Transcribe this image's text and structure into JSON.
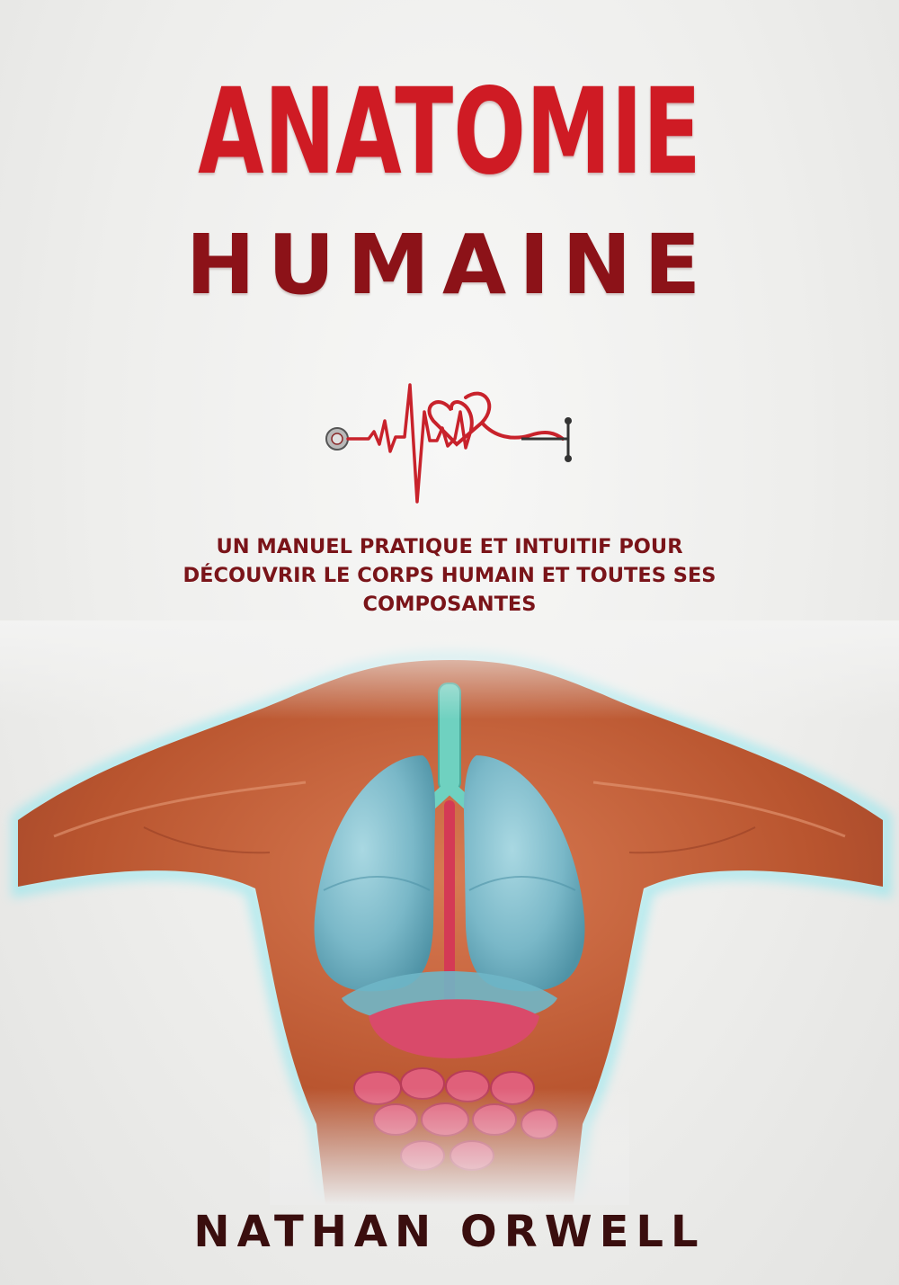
{
  "cover": {
    "title_line1": "ANATOMIE",
    "title_line2": "HUMAINE",
    "subtitle_line1": "UN MANUEL PRATIQUE ET INTUITIF POUR",
    "subtitle_line2": "DÉCOUVRIR LE CORPS HUMAIN ET TOUTES SES",
    "subtitle_line3": "COMPOSANTES",
    "author": "NATHAN ORWELL"
  },
  "icons": {
    "heartbeat": "stethoscope-heartbeat-icon",
    "illustration": "human-torso-anatomy-illustration"
  },
  "colors": {
    "title_red": "#cf1b24",
    "title_dark_red": "#8c1218",
    "subtitle": "#7a1419",
    "author": "#3a0e0e",
    "lungs": "#7fc0cf",
    "muscle": "#c8623f"
  }
}
